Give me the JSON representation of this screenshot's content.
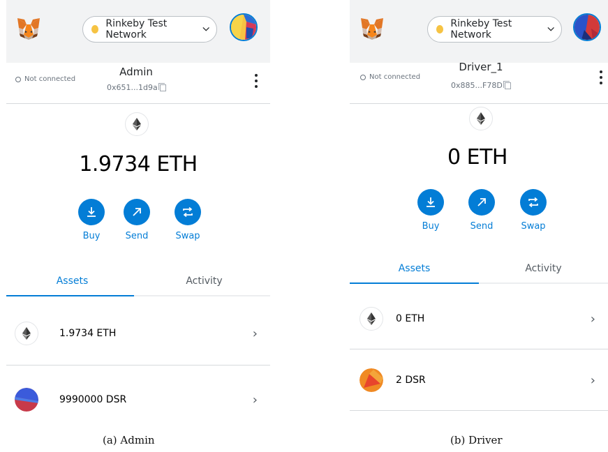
{
  "colors": {
    "accent": "#037dd6",
    "network_dot": "#f6c343",
    "header_bg": "#f2f3f4"
  },
  "panels": [
    {
      "network": "Rinkeby Test Network",
      "connection": "Not connected",
      "account_name": "Admin",
      "account_address": "0x651...1d9a",
      "balance": "1.9734 ETH",
      "actions": [
        "Buy",
        "Send",
        "Swap"
      ],
      "tabs": [
        "Assets",
        "Activity"
      ],
      "assets": [
        {
          "label": "1.9734 ETH",
          "icon": "eth-icon"
        },
        {
          "label": "9990000 DSR",
          "icon": "dsr-token-icon"
        }
      ],
      "caption": "(a) Admin"
    },
    {
      "network": "Rinkeby Test Network",
      "connection": "Not connected",
      "account_name": "Driver_1",
      "account_address": "0x885...F78D",
      "balance": "0 ETH",
      "actions": [
        "Buy",
        "Send",
        "Swap"
      ],
      "tabs": [
        "Assets",
        "Activity"
      ],
      "assets": [
        {
          "label": "0 ETH",
          "icon": "eth-icon"
        },
        {
          "label": "2 DSR",
          "icon": "dsr-token-icon"
        }
      ],
      "caption": "(b) Driver"
    }
  ]
}
